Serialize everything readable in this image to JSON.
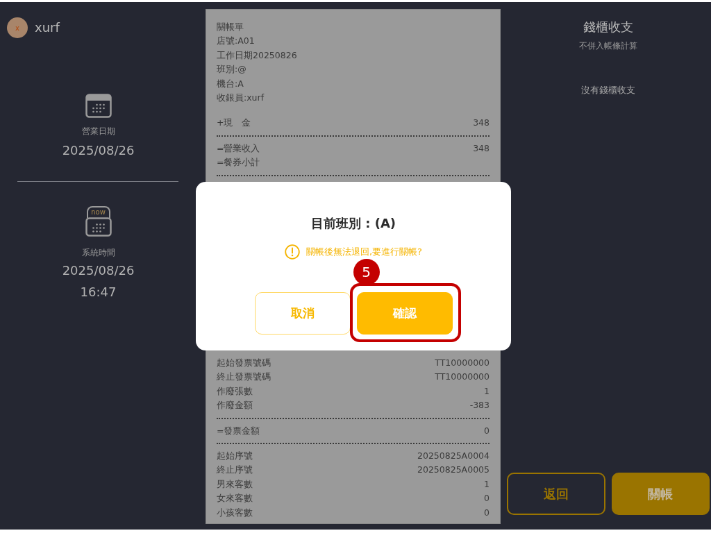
{
  "user": {
    "avatar_initial": "x",
    "name": "xurf"
  },
  "sidebar": {
    "business_date": {
      "label": "營業日期",
      "date": "2025/08/26"
    },
    "system_time": {
      "tag": "now",
      "label": "系統時間",
      "date": "2025/08/26",
      "time": "16:47"
    }
  },
  "receipt": {
    "lines_above": [
      {
        "kind": "row",
        "label": "關帳單"
      },
      {
        "kind": "row",
        "label": "店號:A01"
      },
      {
        "kind": "row",
        "label": "工作日期20250826"
      },
      {
        "kind": "row",
        "label": "班別:@"
      },
      {
        "kind": "row",
        "label": "機台:A"
      },
      {
        "kind": "row",
        "label": "收銀員:xurf"
      },
      {
        "kind": "blank"
      },
      {
        "kind": "row",
        "label": "+現　金",
        "value": "348"
      },
      {
        "kind": "divider"
      },
      {
        "kind": "row",
        "label": "=營業收入",
        "value": "348"
      },
      {
        "kind": "row",
        "label": "=餐券小計"
      },
      {
        "kind": "divider"
      }
    ],
    "lines_below": [
      {
        "kind": "row",
        "label": "起始發票號碼",
        "value": "TT10000000"
      },
      {
        "kind": "row",
        "label": "終止發票號碼",
        "value": "TT10000000"
      },
      {
        "kind": "row",
        "label": "作廢張數",
        "value": "1"
      },
      {
        "kind": "row",
        "label": "作廢金額",
        "value": "-383"
      },
      {
        "kind": "divider"
      },
      {
        "kind": "row",
        "label": "=發票金額",
        "value": "0"
      },
      {
        "kind": "divider"
      },
      {
        "kind": "row",
        "label": "起始序號",
        "value": "20250825A0004"
      },
      {
        "kind": "row",
        "label": "終止序號",
        "value": "20250825A0005"
      },
      {
        "kind": "row",
        "label": "男來客數",
        "value": "1"
      },
      {
        "kind": "row",
        "label": "女來客數",
        "value": "0"
      },
      {
        "kind": "row",
        "label": "小孩客數",
        "value": "0"
      }
    ]
  },
  "cash_drawer": {
    "title": "錢櫃收支",
    "subtitle": "不併入帳條計算",
    "empty_message": "沒有錢櫃收支"
  },
  "footer_buttons": [
    {
      "label": "返回",
      "kind": "outline"
    },
    {
      "label": "關帳",
      "kind": "filled"
    }
  ],
  "dialog": {
    "title": "目前班別 : (A)",
    "warning": "關帳後無法退回,要進行關帳?",
    "buttons": [
      {
        "label": "取消",
        "kind": "outline",
        "highlighted": false
      },
      {
        "label": "確認",
        "kind": "filled",
        "highlighted": true
      }
    ]
  },
  "step_marker": {
    "label": "5"
  }
}
